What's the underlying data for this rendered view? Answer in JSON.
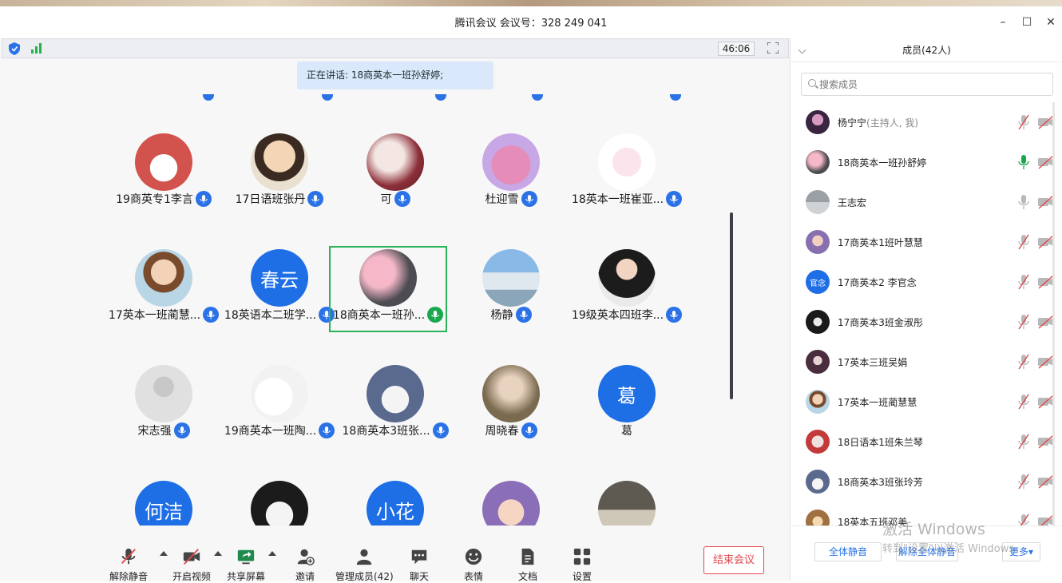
{
  "window": {
    "title": "腾讯会议 会议号：328 249 041",
    "minimize": "–",
    "maximize": "☐",
    "close": "✕"
  },
  "infobar": {
    "timer": "46:06"
  },
  "speaking": "正在讲话: 18商英本一班孙舒婷;",
  "grid": {
    "tiles": [
      {
        "name": "19商英专1李言",
        "mic": "active"
      },
      {
        "name": "17日语班张丹",
        "mic": "active"
      },
      {
        "name": "可",
        "mic": "active"
      },
      {
        "name": "杜迎雪",
        "mic": "active"
      },
      {
        "name": "18英本一班崔亚...",
        "mic": "active"
      },
      {
        "name": "17英本一班蔺慧...",
        "mic": "active"
      },
      {
        "name": "18英语本二班学...",
        "mic": "active",
        "avatar_text": "春云"
      },
      {
        "name": "18商英本一班孙...",
        "mic": "speaking"
      },
      {
        "name": "杨静",
        "mic": "active"
      },
      {
        "name": "19级英本四班李...",
        "mic": "active"
      },
      {
        "name": "宋志强",
        "mic": "active"
      },
      {
        "name": "19商英本一班陶...",
        "mic": "active"
      },
      {
        "name": "18商英本3班张...",
        "mic": "active"
      },
      {
        "name": "周晓春",
        "mic": "active"
      },
      {
        "name": "葛",
        "mic": "none",
        "avatar_text": "葛"
      },
      {
        "name": "",
        "mic": "none",
        "avatar_text": "何洁"
      },
      {
        "name": "",
        "mic": "none"
      },
      {
        "name": "",
        "mic": "none",
        "avatar_text": "小花"
      },
      {
        "name": "",
        "mic": "none"
      },
      {
        "name": "",
        "mic": "none"
      }
    ]
  },
  "toolbar": {
    "unmute": "解除静音",
    "video": "开启视频",
    "share": "共享屏幕",
    "invite": "邀请",
    "manage": "管理成员(42)",
    "chat": "聊天",
    "emoji": "表情",
    "docs": "文档",
    "settings": "设置",
    "end": "结束会议"
  },
  "members_panel": {
    "header": "成员(42人)",
    "search_placeholder": "搜索成员",
    "list": [
      {
        "name": "杨宁宁",
        "role": "(主持人, 我)",
        "mic": "muted"
      },
      {
        "name": "18商英本一班孙舒婷",
        "role": "",
        "mic": "speaking"
      },
      {
        "name": "王志宏",
        "role": "",
        "mic": "on"
      },
      {
        "name": "17商英本1班叶慧慧",
        "role": "",
        "mic": "muted"
      },
      {
        "name": "17商英本2 李官念",
        "role": "",
        "mic": "muted",
        "avatar_text": "官念"
      },
      {
        "name": "17商英本3班金淑彤",
        "role": "",
        "mic": "muted"
      },
      {
        "name": "17英本三班吴娟",
        "role": "",
        "mic": "muted"
      },
      {
        "name": "17英本一班蔺慧慧",
        "role": "",
        "mic": "muted"
      },
      {
        "name": "18日语本1班朱兰琴",
        "role": "",
        "mic": "muted"
      },
      {
        "name": "18商英本3班张玲芳",
        "role": "",
        "mic": "muted"
      },
      {
        "name": "18英本五班邓美",
        "role": "",
        "mic": "muted"
      }
    ],
    "mute_all": "全体静音",
    "unmute_all": "解除全体静音",
    "more": "更多"
  },
  "watermark": {
    "line1": "激活 Windows",
    "line2": "转到\"设置\"以激活 Windows。"
  },
  "colors": {
    "accent": "#2a72e6",
    "speaking": "#1aa84f",
    "end_red": "#e0474c"
  }
}
